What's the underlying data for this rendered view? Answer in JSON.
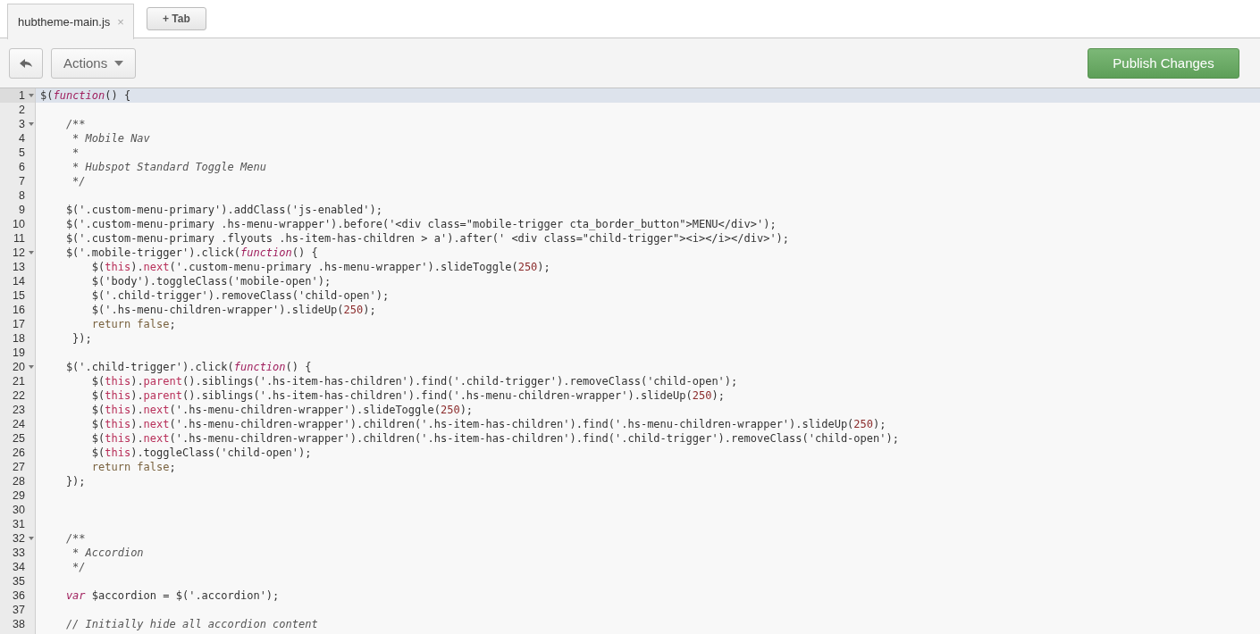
{
  "tabs": [
    {
      "label": "hubtheme-main.js",
      "selected": true,
      "close": "×"
    }
  ],
  "add_tab_button": "+ Tab",
  "toolbar": {
    "actions_label": "Actions",
    "publish_label": "Publish Changes"
  },
  "editor": {
    "lines": [
      {
        "number": "1",
        "foldable": true,
        "active": true,
        "tokens": [
          {
            "kind": "plain",
            "text": "$("
          },
          {
            "kind": "keyword",
            "text": "function"
          },
          {
            "kind": "plain",
            "text": "() {"
          }
        ]
      },
      {
        "number": "2",
        "foldable": false,
        "active": false
      },
      {
        "number": "3",
        "foldable": true,
        "active": false,
        "tokens": [
          {
            "kind": "comment",
            "text": "    /**"
          }
        ]
      },
      {
        "number": "4",
        "foldable": false,
        "active": false,
        "tokens": [
          {
            "kind": "comment",
            "text": "     * Mobile Nav"
          }
        ]
      },
      {
        "number": "5",
        "foldable": false,
        "active": false,
        "tokens": [
          {
            "kind": "comment",
            "text": "     *"
          }
        ]
      },
      {
        "number": "6",
        "foldable": false,
        "active": false,
        "tokens": [
          {
            "kind": "comment",
            "text": "     * Hubspot Standard Toggle Menu"
          }
        ]
      },
      {
        "number": "7",
        "foldable": false,
        "active": false,
        "tokens": [
          {
            "kind": "comment",
            "text": "     */"
          }
        ]
      },
      {
        "number": "8",
        "foldable": false,
        "active": false
      },
      {
        "number": "9",
        "foldable": false,
        "active": false,
        "tokens": [
          {
            "kind": "plain",
            "text": "    $('.custom-menu-primary').addClass('js-enabled');"
          }
        ]
      },
      {
        "number": "10",
        "foldable": false,
        "active": false,
        "tokens": [
          {
            "kind": "plain",
            "text": "    $('.custom-menu-primary .hs-menu-wrapper').before('<div class=\"mobile-trigger cta_border_button\">MENU</div>');"
          }
        ]
      },
      {
        "number": "11",
        "foldable": false,
        "active": false,
        "tokens": [
          {
            "kind": "plain",
            "text": "    $('.custom-menu-primary .flyouts .hs-item-has-children > a').after(' <div class=\"child-trigger\"><i></i></div>');"
          }
        ]
      },
      {
        "number": "12",
        "foldable": true,
        "active": false,
        "tokens": [
          {
            "kind": "plain",
            "text": "    $('.mobile-trigger').click("
          },
          {
            "kind": "keyword",
            "text": "function"
          },
          {
            "kind": "plain",
            "text": "() {"
          }
        ]
      },
      {
        "number": "13",
        "foldable": false,
        "active": false,
        "tokens": [
          {
            "kind": "plain",
            "text": "        $("
          },
          {
            "kind": "builtin",
            "text": "this"
          },
          {
            "kind": "plain",
            "text": ")."
          },
          {
            "kind": "builtin",
            "text": "next"
          },
          {
            "kind": "plain",
            "text": "('.custom-menu-primary .hs-menu-wrapper').slideToggle("
          },
          {
            "kind": "number",
            "text": "250"
          },
          {
            "kind": "plain",
            "text": ");"
          }
        ]
      },
      {
        "number": "14",
        "foldable": false,
        "active": false,
        "tokens": [
          {
            "kind": "plain",
            "text": "        $('body').toggleClass('mobile-open');"
          }
        ]
      },
      {
        "number": "15",
        "foldable": false,
        "active": false,
        "tokens": [
          {
            "kind": "plain",
            "text": "        $('.child-trigger').removeClass('child-open');"
          }
        ]
      },
      {
        "number": "16",
        "foldable": false,
        "active": false,
        "tokens": [
          {
            "kind": "plain",
            "text": "        $('.hs-menu-children-wrapper').slideUp("
          },
          {
            "kind": "number",
            "text": "250"
          },
          {
            "kind": "plain",
            "text": ");"
          }
        ]
      },
      {
        "number": "17",
        "foldable": false,
        "active": false,
        "tokens": [
          {
            "kind": "control",
            "text": "        return false"
          },
          {
            "kind": "plain",
            "text": ";"
          }
        ]
      },
      {
        "number": "18",
        "foldable": false,
        "active": false,
        "tokens": [
          {
            "kind": "plain",
            "text": "     });"
          }
        ]
      },
      {
        "number": "19",
        "foldable": false,
        "active": false
      },
      {
        "number": "20",
        "foldable": true,
        "active": false,
        "tokens": [
          {
            "kind": "plain",
            "text": "    $('.child-trigger').click("
          },
          {
            "kind": "keyword",
            "text": "function"
          },
          {
            "kind": "plain",
            "text": "() {"
          }
        ]
      },
      {
        "number": "21",
        "foldable": false,
        "active": false,
        "tokens": [
          {
            "kind": "plain",
            "text": "        $("
          },
          {
            "kind": "builtin",
            "text": "this"
          },
          {
            "kind": "plain",
            "text": ")."
          },
          {
            "kind": "builtin",
            "text": "parent"
          },
          {
            "kind": "plain",
            "text": "().siblings('.hs-item-has-children').find('.child-trigger').removeClass('child-open');"
          }
        ]
      },
      {
        "number": "22",
        "foldable": false,
        "active": false,
        "tokens": [
          {
            "kind": "plain",
            "text": "        $("
          },
          {
            "kind": "builtin",
            "text": "this"
          },
          {
            "kind": "plain",
            "text": ")."
          },
          {
            "kind": "builtin",
            "text": "parent"
          },
          {
            "kind": "plain",
            "text": "().siblings('.hs-item-has-children').find('.hs-menu-children-wrapper').slideUp("
          },
          {
            "kind": "number",
            "text": "250"
          },
          {
            "kind": "plain",
            "text": ");"
          }
        ]
      },
      {
        "number": "23",
        "foldable": false,
        "active": false,
        "tokens": [
          {
            "kind": "plain",
            "text": "        $("
          },
          {
            "kind": "builtin",
            "text": "this"
          },
          {
            "kind": "plain",
            "text": ")."
          },
          {
            "kind": "builtin",
            "text": "next"
          },
          {
            "kind": "plain",
            "text": "('.hs-menu-children-wrapper').slideToggle("
          },
          {
            "kind": "number",
            "text": "250"
          },
          {
            "kind": "plain",
            "text": ");"
          }
        ]
      },
      {
        "number": "24",
        "foldable": false,
        "active": false,
        "tokens": [
          {
            "kind": "plain",
            "text": "        $("
          },
          {
            "kind": "builtin",
            "text": "this"
          },
          {
            "kind": "plain",
            "text": ")."
          },
          {
            "kind": "builtin",
            "text": "next"
          },
          {
            "kind": "plain",
            "text": "('.hs-menu-children-wrapper').children('.hs-item-has-children').find('.hs-menu-children-wrapper').slideUp("
          },
          {
            "kind": "number",
            "text": "250"
          },
          {
            "kind": "plain",
            "text": ");"
          }
        ]
      },
      {
        "number": "25",
        "foldable": false,
        "active": false,
        "tokens": [
          {
            "kind": "plain",
            "text": "        $("
          },
          {
            "kind": "builtin",
            "text": "this"
          },
          {
            "kind": "plain",
            "text": ")."
          },
          {
            "kind": "builtin",
            "text": "next"
          },
          {
            "kind": "plain",
            "text": "('.hs-menu-children-wrapper').children('.hs-item-has-children').find('.child-trigger').removeClass('child-open');"
          }
        ]
      },
      {
        "number": "26",
        "foldable": false,
        "active": false,
        "tokens": [
          {
            "kind": "plain",
            "text": "        $("
          },
          {
            "kind": "builtin",
            "text": "this"
          },
          {
            "kind": "plain",
            "text": ").toggleClass('child-open');"
          }
        ]
      },
      {
        "number": "27",
        "foldable": false,
        "active": false,
        "tokens": [
          {
            "kind": "control",
            "text": "        return false"
          },
          {
            "kind": "plain",
            "text": ";"
          }
        ]
      },
      {
        "number": "28",
        "foldable": false,
        "active": false,
        "tokens": [
          {
            "kind": "plain",
            "text": "    });"
          }
        ]
      },
      {
        "number": "29",
        "foldable": false,
        "active": false
      },
      {
        "number": "30",
        "foldable": false,
        "active": false
      },
      {
        "number": "31",
        "foldable": false,
        "active": false
      },
      {
        "number": "32",
        "foldable": true,
        "active": false,
        "tokens": [
          {
            "kind": "comment",
            "text": "    /**"
          }
        ]
      },
      {
        "number": "33",
        "foldable": false,
        "active": false,
        "tokens": [
          {
            "kind": "comment",
            "text": "     * Accordion"
          }
        ]
      },
      {
        "number": "34",
        "foldable": false,
        "active": false,
        "tokens": [
          {
            "kind": "comment",
            "text": "     */"
          }
        ]
      },
      {
        "number": "35",
        "foldable": false,
        "active": false
      },
      {
        "number": "36",
        "foldable": false,
        "active": false,
        "tokens": [
          {
            "kind": "keyword",
            "text": "    var"
          },
          {
            "kind": "plain",
            "text": " $accordion = $('.accordion');"
          }
        ]
      },
      {
        "number": "37",
        "foldable": false,
        "active": false
      },
      {
        "number": "38",
        "foldable": false,
        "active": false,
        "tokens": [
          {
            "kind": "comment",
            "text": "    // Initially hide all accordion content"
          }
        ]
      }
    ]
  }
}
